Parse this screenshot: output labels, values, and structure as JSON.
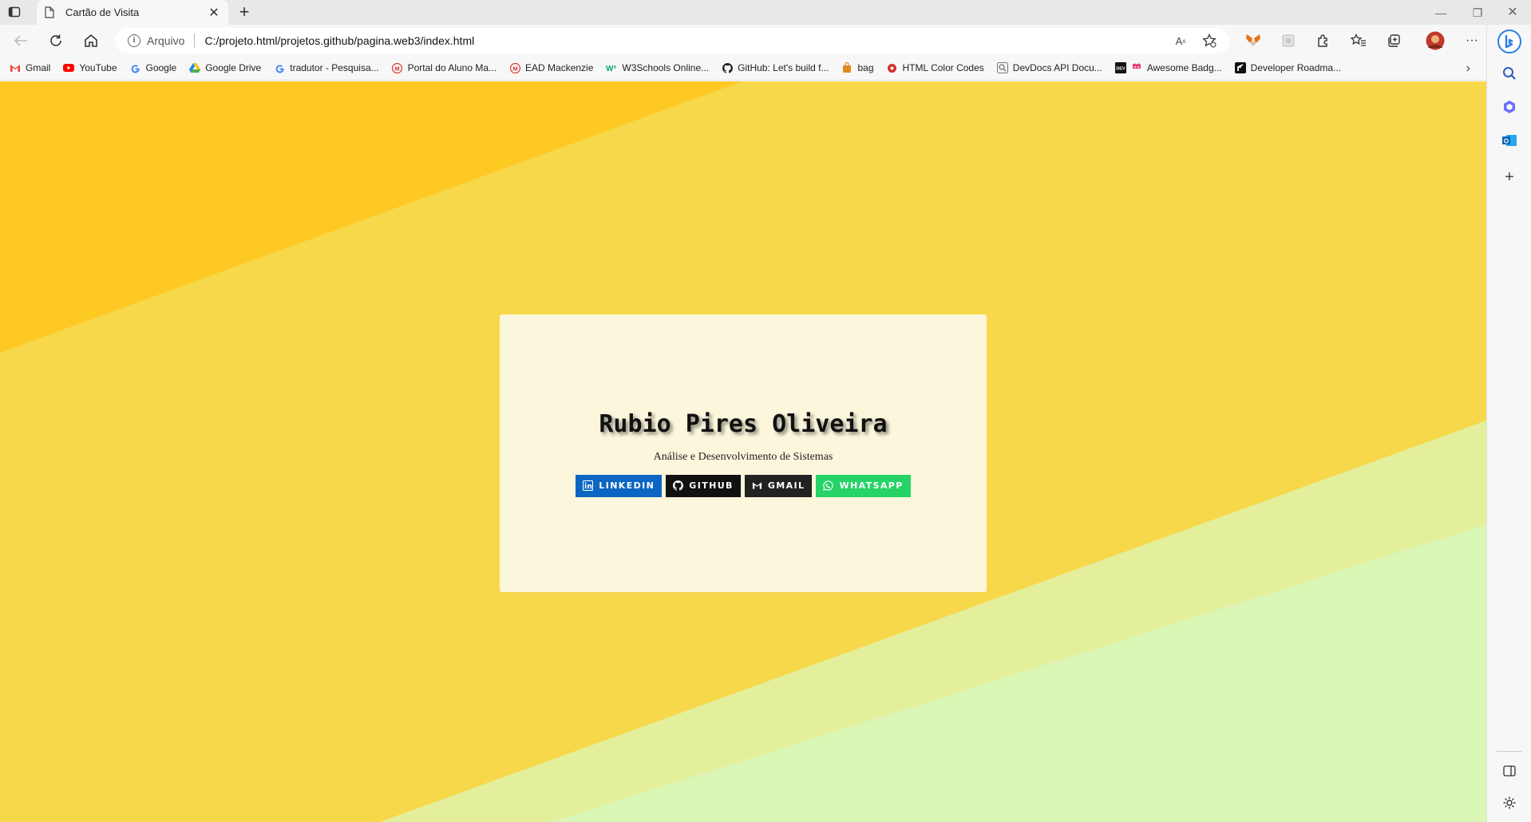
{
  "browser": {
    "tab": {
      "title": "Cartão de Visita"
    },
    "address": {
      "scheme_label": "Arquivo",
      "url": "C:/projeto.html/projetos.github/pagina.web3/index.html"
    },
    "bookmarks": [
      {
        "label": "Gmail",
        "icon": "gmail-icon",
        "color": "#ea4335"
      },
      {
        "label": "YouTube",
        "icon": "youtube-icon",
        "color": "#ff0000"
      },
      {
        "label": "Google",
        "icon": "google-icon",
        "color": "#4285f4"
      },
      {
        "label": "Google Drive",
        "icon": "google-drive-icon",
        "color": "#34a853"
      },
      {
        "label": "tradutor - Pesquisa...",
        "icon": "google-icon",
        "color": "#4285f4"
      },
      {
        "label": "Portal do Aluno Ma...",
        "icon": "mackenzie-icon",
        "color": "#d6302b"
      },
      {
        "label": "EAD Mackenzie",
        "icon": "mackenzie-icon",
        "color": "#d6302b"
      },
      {
        "label": "W3Schools Online...",
        "icon": "w3schools-icon",
        "color": "#04aa6d"
      },
      {
        "label": "GitHub: Let's build f...",
        "icon": "github-icon",
        "color": "#1b1f23"
      },
      {
        "label": "bag",
        "icon": "bag-icon",
        "color": "#e08a1e"
      },
      {
        "label": "HTML Color Codes",
        "icon": "color-codes-icon",
        "color": "#d6302b"
      },
      {
        "label": "DevDocs API Docu...",
        "icon": "devdocs-icon",
        "color": "#777777"
      },
      {
        "label": "Awesome Badg...",
        "icon": "awesome-badges-icon",
        "color": "#e63e6d"
      },
      {
        "label": "Developer Roadma...",
        "icon": "roadmap-icon",
        "color": "#111111"
      }
    ]
  },
  "page": {
    "card": {
      "name": "Rubio Pires Oliveira",
      "subtitle": "Análise e Desenvolvimento de Sistemas",
      "links": [
        {
          "label": "LINKEDIN",
          "icon": "linkedin-icon",
          "color": "#0a66c2"
        },
        {
          "label": "GITHUB",
          "icon": "github-icon",
          "color": "#111111"
        },
        {
          "label": "GMAIL",
          "icon": "gmail-icon",
          "color": "#222222"
        },
        {
          "label": "WHATSAPP",
          "icon": "whatsapp-icon",
          "color": "#25d366"
        }
      ]
    },
    "colors": {
      "background_main": "#f6d84a",
      "background_top_left": "#ffc924",
      "background_bottom_right_light": "#e4ef9c",
      "background_bottom_right_lighter": "#dbf7b6",
      "card": "#fcf6dc"
    }
  }
}
